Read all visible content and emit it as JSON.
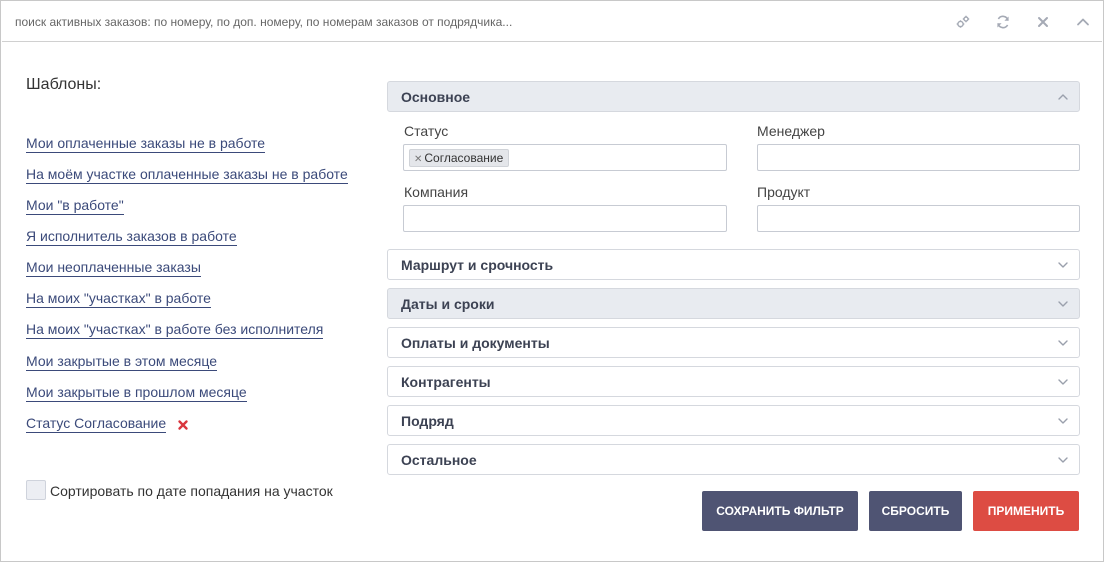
{
  "search": {
    "placeholder": "поиск активных заказов: по номеру, по доп. номеру, по номерам заказов от подрядчика..."
  },
  "toolbar": {
    "icons": [
      "settings-icon",
      "refresh-icon",
      "close-icon",
      "chevron-up-icon"
    ]
  },
  "templates": {
    "title": "Шаблоны:",
    "items": [
      "Мои оплаченные заказы не в работе",
      "На моём участке оплаченные заказы не в работе",
      "Мои \"в работе\"",
      "Я исполнитель заказов в работе",
      "Мои неоплаченные заказы",
      "На моих \"участках\" в работе",
      "На моих \"участках\" в работе без исполнителя",
      "Мои закрытые в этом месяце",
      "Мои закрытые в прошлом месяце",
      "Статус Согласование"
    ]
  },
  "sort": {
    "label": "Сортировать по дате попадания на участок",
    "checked": false
  },
  "sections": {
    "main": {
      "label": "Основное",
      "expanded": true,
      "fields": {
        "status_label": "Статус",
        "status_tag": "Согласование",
        "manager_label": "Менеджер",
        "manager_value": "",
        "company_label": "Компания",
        "company_value": "",
        "product_label": "Продукт",
        "product_value": ""
      }
    },
    "collapsed": [
      "Маршрут и срочность",
      "Даты и сроки",
      "Оплаты и документы",
      "Контрагенты",
      "Подряд",
      "Остальное"
    ]
  },
  "buttons": {
    "save": "СОХРАНИТЬ ФИЛЬТР",
    "reset": "СБРОСИТЬ",
    "apply": "ПРИМЕНИТЬ"
  },
  "colors": {
    "link": "#3b4a7a",
    "dark_button": "#4f5473",
    "apply_button": "#dd4c43",
    "remove_icon": "#d9363e",
    "section_shaded": "#e8ebf0"
  }
}
